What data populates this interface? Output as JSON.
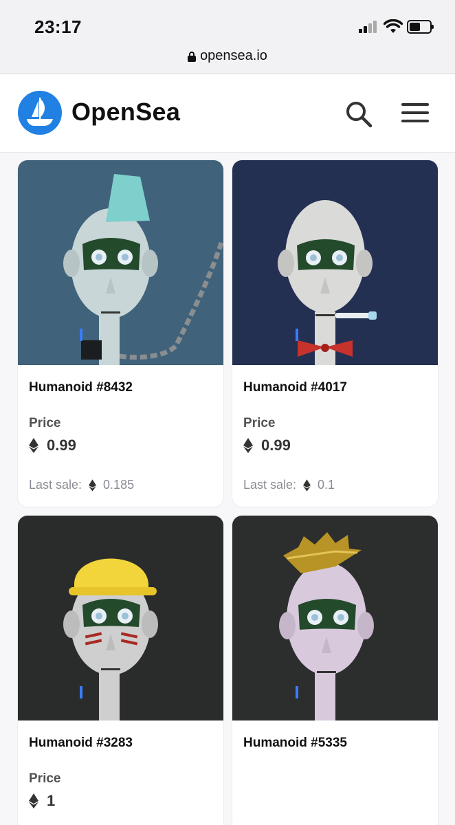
{
  "status_bar": {
    "time": "23:17"
  },
  "browser": {
    "url": "opensea.io"
  },
  "header": {
    "brand": "OpenSea"
  },
  "cards": [
    {
      "name": "Humanoid #8432",
      "price_label": "Price",
      "price": "0.99",
      "last_sale_label": "Last sale:",
      "last_sale": "0.185",
      "bg": "#40627a",
      "face": "#c8d6d8",
      "accessory": "mohawk"
    },
    {
      "name": "Humanoid #4017",
      "price_label": "Price",
      "price": "0.99",
      "last_sale_label": "Last sale:",
      "last_sale": "0.1",
      "bg": "#233052",
      "face": "#dadbd8",
      "accessory": "bowtie"
    },
    {
      "name": "Humanoid #3283",
      "price_label": "Price",
      "price": "1",
      "bg": "#2a2c2b",
      "face": "#cfcfcf",
      "accessory": "hardhat"
    },
    {
      "name": "Humanoid #5335",
      "bg": "#2c2e2d",
      "face": "#d8c9dc",
      "accessory": "crown"
    }
  ],
  "colors": {
    "brand_blue": "#2081e2",
    "mask_green": "#244a2c"
  }
}
